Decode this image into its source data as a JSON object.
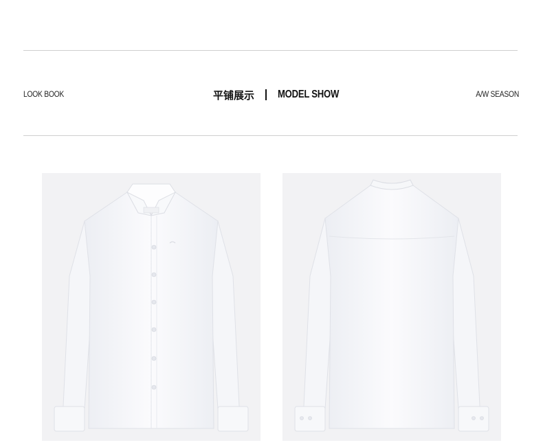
{
  "header": {
    "left_label": "LOOK BOOK",
    "title_cn": "平铺展示",
    "title_en": "MODEL SHOW",
    "right_label": "A/W SEASON"
  },
  "gallery": {
    "items": [
      {
        "view": "front",
        "subject": "white long-sleeve shirt"
      },
      {
        "view": "back",
        "subject": "white long-sleeve shirt"
      }
    ]
  },
  "colors": {
    "background": "#ffffff",
    "rule": "#cfcfcf",
    "photo_bg": "#f2f2f4",
    "shirt": "#fbfbfd"
  }
}
